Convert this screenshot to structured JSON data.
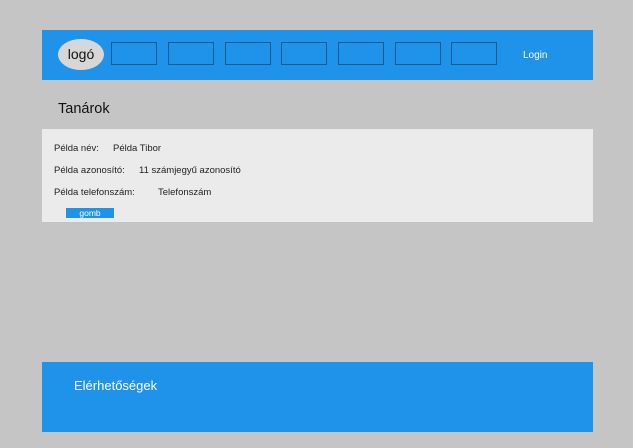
{
  "header": {
    "logo_text": "logó",
    "nav_items": [
      "",
      "",
      "",
      "",
      "",
      "",
      ""
    ],
    "login_label": "Login"
  },
  "page": {
    "title": "Tanárok"
  },
  "card": {
    "rows": [
      {
        "label": "Példa név:",
        "value": "Példa Tibor"
      },
      {
        "label": "Példa azonosító:",
        "value": "11 számjegyű azonosító"
      },
      {
        "label": "Példa telefonszám:",
        "value": "Telefonszám"
      }
    ],
    "button_label": "gomb"
  },
  "footer": {
    "title": "Elérhetőségek"
  },
  "colors": {
    "background": "#c5c5c5",
    "accent": "#1f93ea",
    "card_bg": "#ebebeb",
    "logo_bg": "#d7d7d7"
  }
}
